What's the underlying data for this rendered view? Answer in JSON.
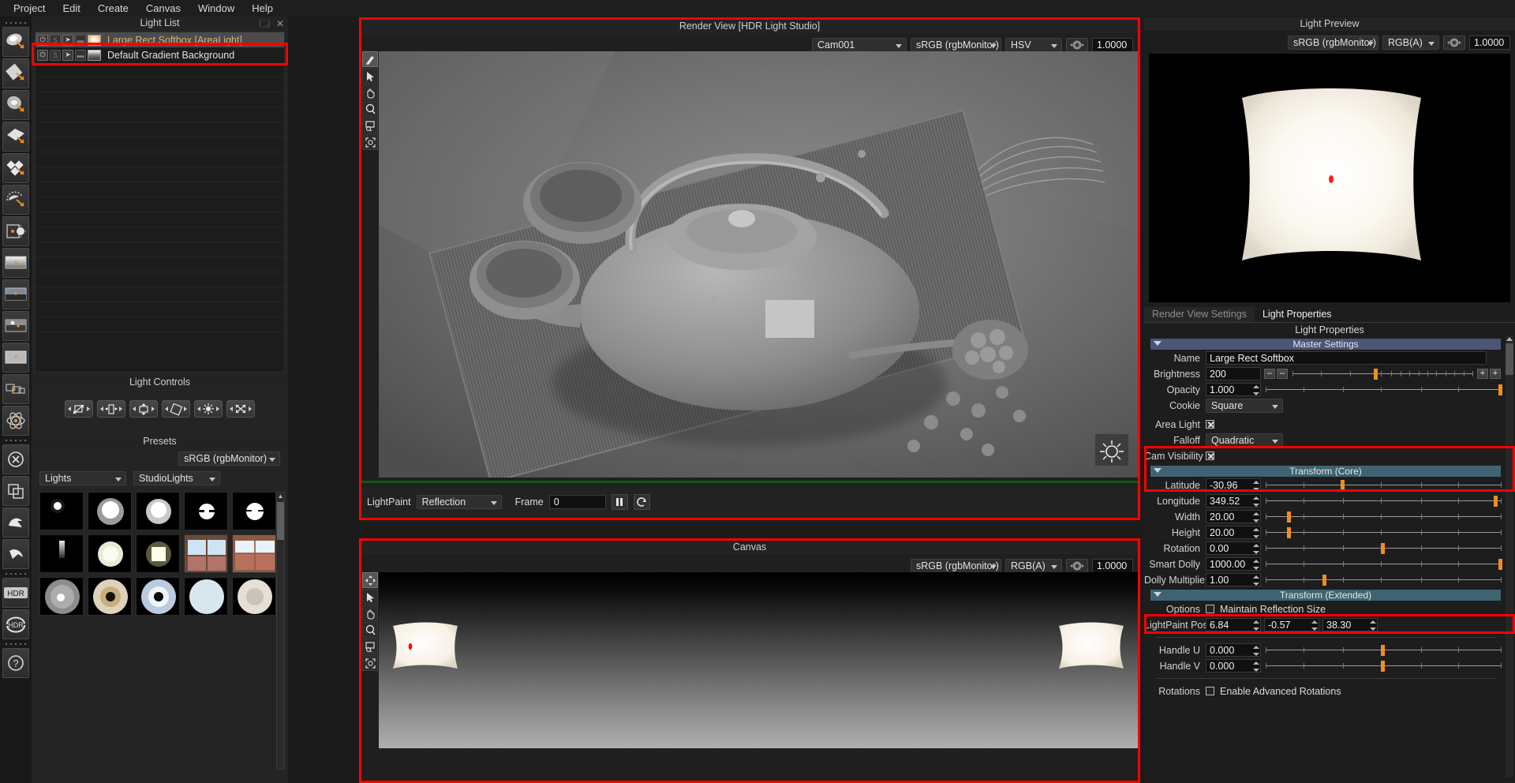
{
  "menu": {
    "items": [
      "Project",
      "Edit",
      "Create",
      "Canvas",
      "Window",
      "Help"
    ]
  },
  "accents": {
    "highlight": "#ff0000",
    "slider_handle": "#f08d22",
    "section_blue": "#4a5578",
    "section_teal": "#3e6472",
    "selected_light_text": "#c8bc86"
  },
  "left_rail": {
    "icons": [
      "area-light-icon",
      "rect-light-icon",
      "disc-light-icon",
      "plane-light-icon",
      "multi-light-icon",
      "dome-light-icon",
      "backdrop-light-icon",
      "gradient-strip-icon",
      "hdri-strip-icon",
      "horizon-strip-icon",
      "flat-strip-icon",
      "layers-icon",
      "atom-icon",
      "delete-icon",
      "duplicate-icon",
      "undo-arrow-icon",
      "redo-arrow-icon",
      "hdr-icon",
      "hdr-refresh-icon",
      "help-icon"
    ]
  },
  "light_list": {
    "title": "Light List",
    "rows": [
      {
        "label": "Large Rect Softbox [AreaLight]",
        "selected": true,
        "swatch": "softbox-swatch",
        "toggles": [
          "power-icon",
          "solo-icon",
          "select-icon",
          "lock-icon"
        ]
      },
      {
        "label": "Default Gradient Background",
        "selected": false,
        "swatch": "gradient-swatch",
        "toggles": [
          "power-icon",
          "solo-icon",
          "select-icon",
          "lock-icon"
        ]
      }
    ]
  },
  "light_controls": {
    "title": "Light Controls",
    "buttons": [
      "scale-uniform-icon",
      "scale-width-icon",
      "scale-height-icon",
      "rotate-icon",
      "brightness-icon",
      "move-diagonal-icon"
    ]
  },
  "presets": {
    "title": "Presets",
    "colorspace": "sRGB (rgbMonitor)",
    "category": "Lights",
    "subcategory": "StudioLights",
    "thumbnails": [
      "small-bulb",
      "frosted-sphere",
      "soft-sphere",
      "twin-tube-round",
      "twin-tube-round-2",
      "tube-strip",
      "round-fluorescent",
      "warm-square",
      "window-4pane",
      "window-blind",
      "ring-light",
      "beauty-dish",
      "blue-reflector",
      "soft-octa",
      "beauty-pan"
    ]
  },
  "render_view": {
    "title": "Render View [HDR Light Studio]",
    "camera": "Cam001",
    "colorspace": "sRGB (rgbMonitor)",
    "channel": "HSV",
    "exposure": "1.0000",
    "tools": [
      "lightpaint-brush-icon",
      "select-arrow-icon",
      "pan-hand-icon",
      "zoom-magnifier-icon",
      "zoom-region-icon",
      "zoom-fit-icon"
    ],
    "footer": {
      "lightpaint_label": "LightPaint",
      "lightpaint_mode": "Reflection",
      "frame_label": "Frame",
      "frame_value": "0",
      "pause_icon": "pause-icon",
      "refresh_icon": "refresh-icon"
    },
    "overlay_icon": "sun-gizmo-icon"
  },
  "canvas_panel": {
    "title": "Canvas",
    "colorspace": "sRGB (rgbMonitor)",
    "channel": "RGB(A)",
    "exposure": "1.0000",
    "tools": [
      "move-icon",
      "select-arrow-icon",
      "pan-hand-icon",
      "zoom-magnifier-icon",
      "zoom-region-icon",
      "zoom-fit-icon"
    ]
  },
  "light_preview": {
    "title": "Light Preview",
    "colorspace": "sRGB (rgbMonitor)",
    "channel": "RGB(A)",
    "exposure": "1.0000"
  },
  "light_properties": {
    "tabs": [
      {
        "label": "Render View Settings",
        "active": false
      },
      {
        "label": "Light Properties",
        "active": true
      }
    ],
    "panel_title": "Light Properties",
    "master": {
      "section": "Master Settings",
      "name_label": "Name",
      "name_value": "Large Rect Softbox",
      "brightness_label": "Brightness",
      "brightness_value": "200",
      "brightness_slider_pct": 45,
      "minus_small": "–",
      "minus_big": "–",
      "plus_small": "+",
      "plus_big": "+",
      "opacity_label": "Opacity",
      "opacity_value": "1.000",
      "opacity_slider_pct": 99,
      "cookie_label": "Cookie",
      "cookie_value": "Square",
      "area_light_label": "Area Light",
      "area_light_checked": true,
      "falloff_label": "Falloff",
      "falloff_value": "Quadratic",
      "cam_visibility_label": "Cam Visibility",
      "cam_visibility_checked": true
    },
    "transform_core": {
      "section": "Transform (Core)",
      "rows": [
        {
          "label": "Latitude",
          "value": "-30.96",
          "pct": 32
        },
        {
          "label": "Longitude",
          "value": "349.52",
          "pct": 97
        },
        {
          "label": "Width",
          "value": "20.00",
          "pct": 9
        },
        {
          "label": "Height",
          "value": "20.00",
          "pct": 9
        },
        {
          "label": "Rotation",
          "value": "0.00",
          "pct": 49
        },
        {
          "label": "Smart Dolly",
          "value": "1000.00",
          "pct": 99
        },
        {
          "label": "Dolly Multiplier",
          "value": "1.00",
          "pct": 24
        }
      ]
    },
    "transform_extended": {
      "section": "Transform (Extended)",
      "options_label": "Options",
      "maintain_label": "Maintain Reflection Size",
      "maintain_checked": false,
      "lightpaint_pos_label": "LightPaint Pos",
      "lightpaint_pos": [
        "6.84",
        "-0.57",
        "38.30"
      ],
      "handle_u_label": "Handle U",
      "handle_u_value": "0.000",
      "handle_u_pct": 49,
      "handle_v_label": "Handle V",
      "handle_v_value": "0.000",
      "handle_v_pct": 49,
      "rotations_label": "Rotations",
      "advanced_rotations_label": "Enable Advanced Rotations",
      "advanced_rotations_checked": false
    }
  }
}
